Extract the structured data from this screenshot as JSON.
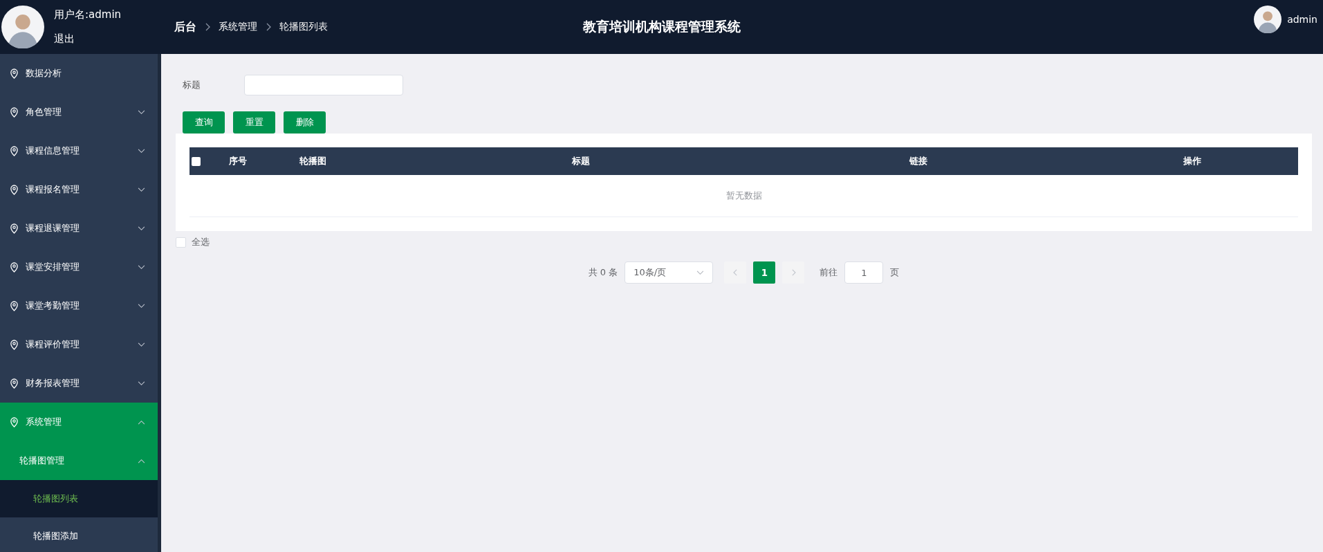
{
  "header": {
    "username": "用户名:admin",
    "logout": "退出",
    "breadcrumb": [
      {
        "label": "后台",
        "selected": false
      },
      {
        "label": "系统管理",
        "selected": false
      },
      {
        "label": "轮播图列表",
        "selected": true
      }
    ],
    "title": "教育培训机构课程管理系统",
    "user": "admin"
  },
  "sidebar": {
    "items": [
      {
        "label": "数据分析",
        "kind": "link",
        "expanded": false
      },
      {
        "label": "角色管理",
        "kind": "submenu",
        "expanded": false
      },
      {
        "label": "课程信息管理",
        "kind": "submenu",
        "expanded": false
      },
      {
        "label": "课程报名管理",
        "kind": "submenu",
        "expanded": false
      },
      {
        "label": "课程退课管理",
        "kind": "submenu",
        "expanded": false
      },
      {
        "label": "课堂安排管理",
        "kind": "submenu",
        "expanded": false
      },
      {
        "label": "课堂考勤管理",
        "kind": "submenu",
        "expanded": false
      },
      {
        "label": "课程评价管理",
        "kind": "submenu",
        "expanded": false
      },
      {
        "label": "财务报表管理",
        "kind": "submenu",
        "expanded": false
      },
      {
        "label": "系统管理",
        "kind": "submenu",
        "expanded": true,
        "children": [
          {
            "label": "轮播图管理",
            "expanded": true,
            "children": [
              {
                "label": "轮播图列表",
                "selected": true
              },
              {
                "label": "轮播图添加",
                "selected": false
              }
            ]
          }
        ]
      }
    ]
  },
  "search": {
    "label": "标题"
  },
  "buttons": [
    "查询",
    "重置",
    "删除"
  ],
  "table": {
    "columns": [
      "序号",
      "轮播图",
      "标题",
      "链接",
      "操作"
    ],
    "header_checked": false,
    "empty_text": "暂无数据"
  },
  "select_all": {
    "label": "全选",
    "checked": false
  },
  "pagination": {
    "total": "共 0 条",
    "page_size": "10条/页",
    "pages": [
      {
        "label": "1",
        "selected": true
      }
    ],
    "goto_label": "前往",
    "goto_value": "1",
    "goto_suffix": "页"
  }
}
